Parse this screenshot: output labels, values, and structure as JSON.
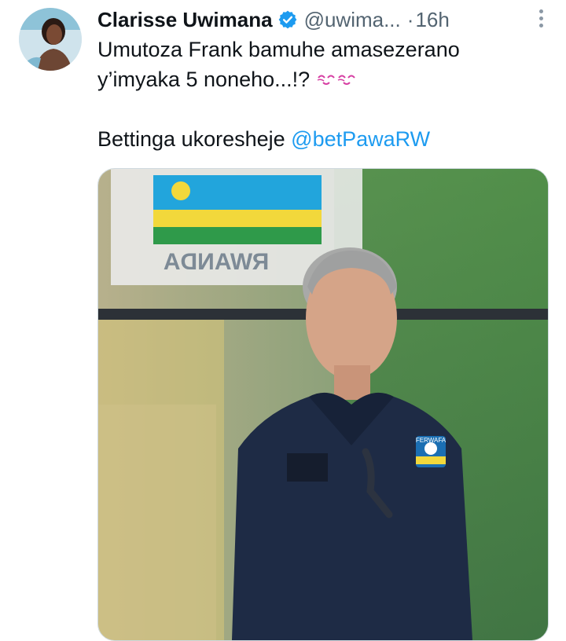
{
  "author": {
    "name": "Clarisse Uwimana",
    "handle": "@uwima...",
    "separator": "·",
    "time": "16h"
  },
  "tweet": {
    "line1": "Umutoza Frank bamuhe amasezerano",
    "line2": "y’imyaka 5 noneho...!?",
    "line3_prefix": "Bettinga ukoresheje ",
    "mention": "@betPawaRW"
  },
  "media": {
    "sign_text": "RWANDA",
    "badge_text": "FERWAFA"
  },
  "icons": {
    "verified": "verified-badge-icon",
    "more": "more-options-icon",
    "emoji": "kissing-face-icon"
  },
  "colors": {
    "accent": "#1d9bf0",
    "text": "#0f1419",
    "muted": "#536471"
  }
}
